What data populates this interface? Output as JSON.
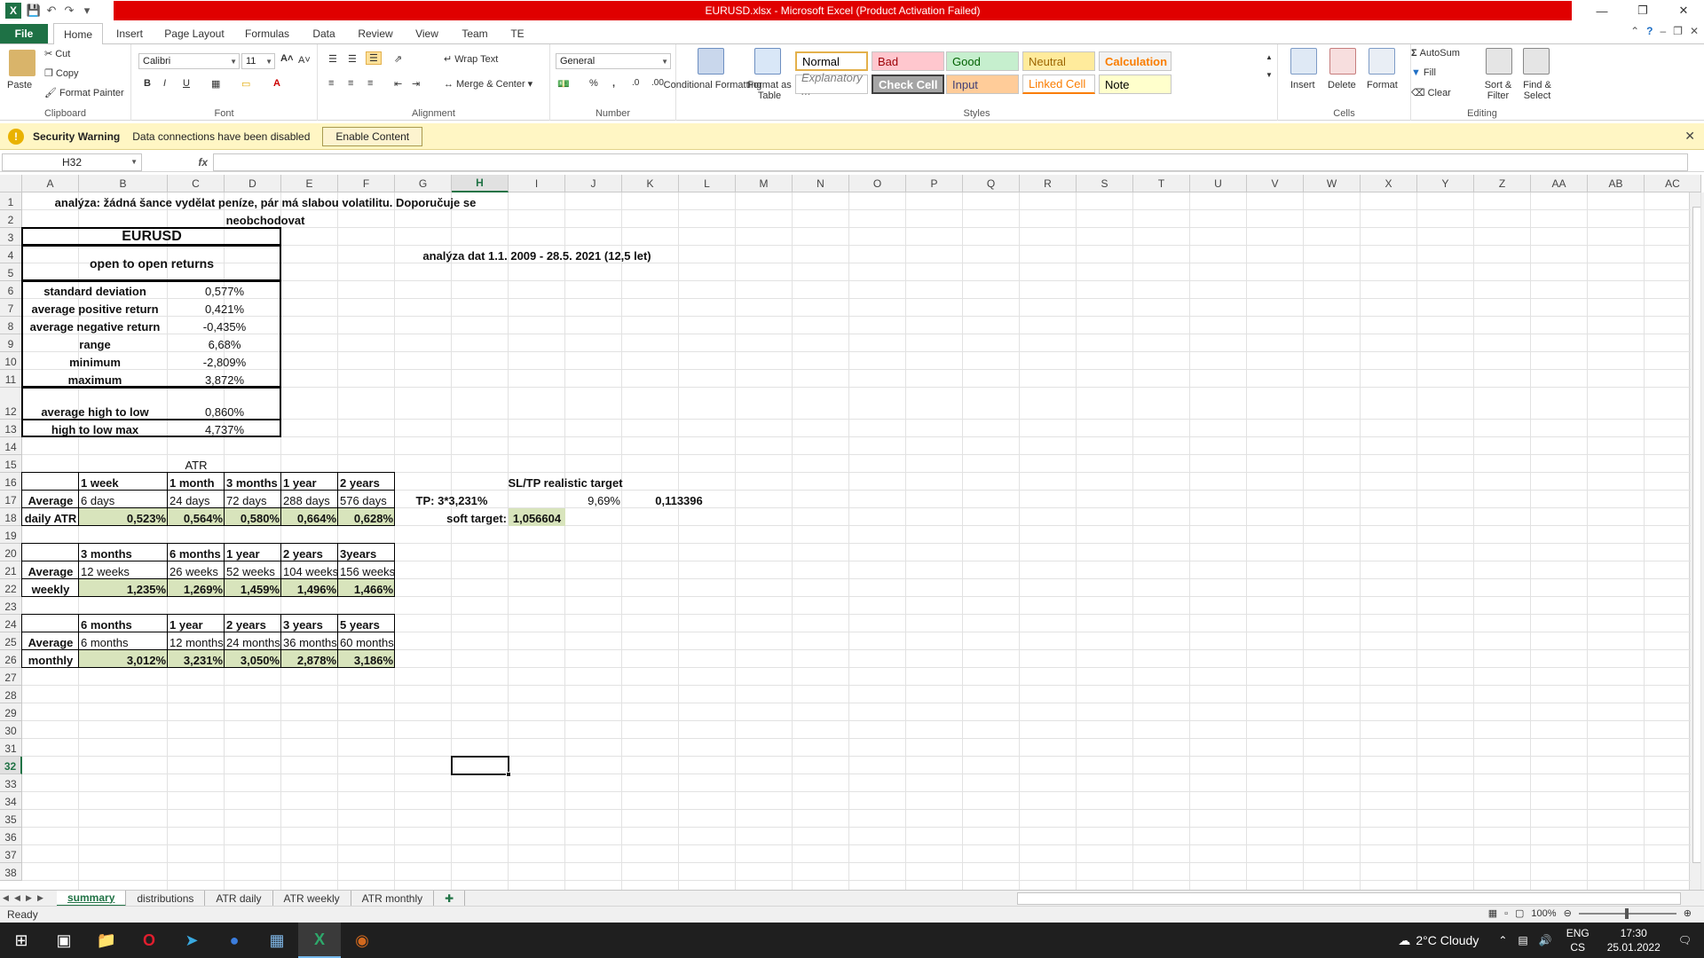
{
  "titlebar": {
    "title": "EURUSD.xlsx  -  Microsoft Excel (Product Activation Failed)",
    "app_icon": "X"
  },
  "ribbon_tabs": [
    "File",
    "Home",
    "Insert",
    "Page Layout",
    "Formulas",
    "Data",
    "Review",
    "View",
    "Team",
    "TE"
  ],
  "ribbon": {
    "clipboard": {
      "paste": "Paste",
      "cut": "Cut",
      "copy": "Copy",
      "format_painter": "Format Painter",
      "label": "Clipboard"
    },
    "font": {
      "name": "Calibri",
      "size": "11",
      "label": "Font"
    },
    "alignment": {
      "wrap": "Wrap Text",
      "merge": "Merge & Center",
      "label": "Alignment"
    },
    "number": {
      "format": "General",
      "percent": "%",
      "comma": ",",
      "label": "Number"
    },
    "styles": {
      "conditional": "Conditional Formatting",
      "format_table": "Format as Table",
      "label": "Styles",
      "items": [
        {
          "name": "Normal",
          "bg": "#ffffff",
          "fg": "#000000"
        },
        {
          "name": "Bad",
          "bg": "#ffc7ce",
          "fg": "#9c0006"
        },
        {
          "name": "Good",
          "bg": "#c6efce",
          "fg": "#006100"
        },
        {
          "name": "Neutral",
          "bg": "#ffeb9c",
          "fg": "#9c6500"
        },
        {
          "name": "Calculation",
          "bg": "#f2f2f2",
          "fg": "#fa7d00"
        },
        {
          "name": "Explanatory ...",
          "bg": "#ffffff",
          "fg": "#7f7f7f"
        },
        {
          "name": "Check Cell",
          "bg": "#a5a5a5",
          "fg": "#ffffff"
        },
        {
          "name": "Input",
          "bg": "#ffcc99",
          "fg": "#3f3f76"
        },
        {
          "name": "Linked Cell",
          "bg": "#ffffff",
          "fg": "#fa7d00"
        },
        {
          "name": "Note",
          "bg": "#ffffcc",
          "fg": "#000000"
        }
      ]
    },
    "cells": {
      "insert": "Insert",
      "delete": "Delete",
      "format": "Format",
      "label": "Cells"
    },
    "editing": {
      "autosum": "AutoSum",
      "fill": "Fill",
      "clear": "Clear",
      "sort": "Sort & Filter",
      "find": "Find & Select",
      "label": "Editing"
    }
  },
  "security": {
    "title": "Security Warning",
    "message": "Data connections have been disabled",
    "button": "Enable Content"
  },
  "formula_bar": {
    "name_box": "H32",
    "fx": "fx",
    "formula": ""
  },
  "columns": [
    "A",
    "B",
    "C",
    "D",
    "E",
    "F",
    "G",
    "H",
    "I",
    "J",
    "K",
    "L",
    "M",
    "N",
    "O",
    "P",
    "Q",
    "R",
    "S",
    "T",
    "U",
    "V",
    "W",
    "X",
    "Y",
    "Z",
    "AA",
    "AB",
    "AC"
  ],
  "selected_column": "H",
  "selected_row": "32",
  "cells": {
    "title_line1": "analýza: žádná šance vydělat peníze, pár má slabou volatilitu. Doporučuje se",
    "title_line2": "neobchodovat",
    "pair": "EURUSD",
    "returns_type": "open to open returns",
    "period": "analýza dat 1.1. 2009 - 28.5. 2021 (12,5 let)",
    "stats": [
      {
        "label": "standard deviation",
        "value": "0,577%"
      },
      {
        "label": "average positive return",
        "value": "0,421%"
      },
      {
        "label": "average negative return",
        "value": "-0,435%"
      },
      {
        "label": "range",
        "value": "6,68%"
      },
      {
        "label": "minimum",
        "value": "-2,809%"
      },
      {
        "label": "maximum",
        "value": "3,872%"
      },
      {
        "label": "average high to low",
        "value": "0,860%"
      },
      {
        "label": "high to low max",
        "value": "4,737%"
      }
    ],
    "atr_title": "ATR",
    "daily": {
      "headers": [
        "1 week",
        "1 month",
        "3 months",
        "1 year",
        "2 years"
      ],
      "row_label_1": "Average",
      "periods": [
        "6 days",
        "24 days",
        "72 days",
        "288 days",
        "576 days"
      ],
      "row_label_2": "daily ATR",
      "values": [
        "0,523%",
        "0,564%",
        "0,580%",
        "0,664%",
        "0,628%"
      ]
    },
    "weekly": {
      "headers": [
        "3 months",
        "6 months",
        "1 year",
        "2 years",
        "3years"
      ],
      "row_label_1": "Average",
      "periods": [
        "12 weeks",
        "26 weeks",
        "52 weeks",
        "104 weeks",
        "156 weeks"
      ],
      "row_label_2": "weekly",
      "values": [
        "1,235%",
        "1,269%",
        "1,459%",
        "1,496%",
        "1,466%"
      ]
    },
    "monthly": {
      "headers": [
        "6 months",
        "1 year",
        "2 years",
        "3 years",
        "5 years"
      ],
      "row_label_1": "Average",
      "periods": [
        "6 months",
        "12 months",
        "24 months",
        "36 months",
        "60 months"
      ],
      "row_label_2": "monthly",
      "values": [
        "3,012%",
        "3,231%",
        "3,050%",
        "2,878%",
        "3,186%"
      ]
    },
    "sltp": {
      "title": "SL/TP realistic target",
      "tp_label": "TP: 3*3,231%",
      "tp_pct": "9,69%",
      "tp_val": "0,113396",
      "soft_label": "soft target:",
      "soft_val": "1,056604"
    }
  },
  "sheets": [
    "summary",
    "distributions",
    "ATR daily",
    "ATR weekly",
    "ATR monthly"
  ],
  "active_sheet": "summary",
  "status": {
    "ready": "Ready",
    "zoom": "100%"
  },
  "taskbar": {
    "weather": "2°C  Cloudy",
    "lang1": "ENG",
    "lang2": "CS",
    "time": "17:30",
    "date": "25.01.2022"
  }
}
